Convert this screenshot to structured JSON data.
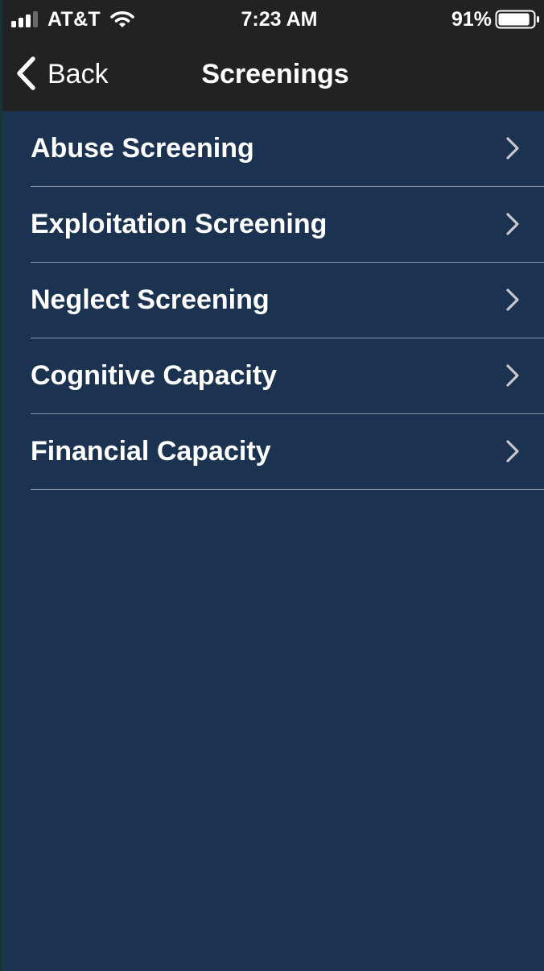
{
  "status_bar": {
    "carrier": "AT&T",
    "time": "7:23 AM",
    "battery_percent": "91%",
    "signal_icon": "cellular-signal-icon",
    "wifi_icon": "wifi-icon",
    "battery_icon": "battery-icon",
    "battery_level": 0.91
  },
  "nav": {
    "back_label": "Back",
    "back_icon": "chevron-left-icon",
    "title": "Screenings"
  },
  "list": {
    "items": [
      {
        "label": "Abuse Screening"
      },
      {
        "label": "Exploitation Screening"
      },
      {
        "label": "Neglect Screening"
      },
      {
        "label": "Cognitive Capacity"
      },
      {
        "label": "Financial Capacity"
      }
    ],
    "disclosure_icon": "chevron-right-icon"
  },
  "colors": {
    "nav_background": "#222222",
    "content_background": "#1b3350",
    "separator": "#8a97a8",
    "text": "#ffffff",
    "chevron": "#c7c7cc"
  }
}
